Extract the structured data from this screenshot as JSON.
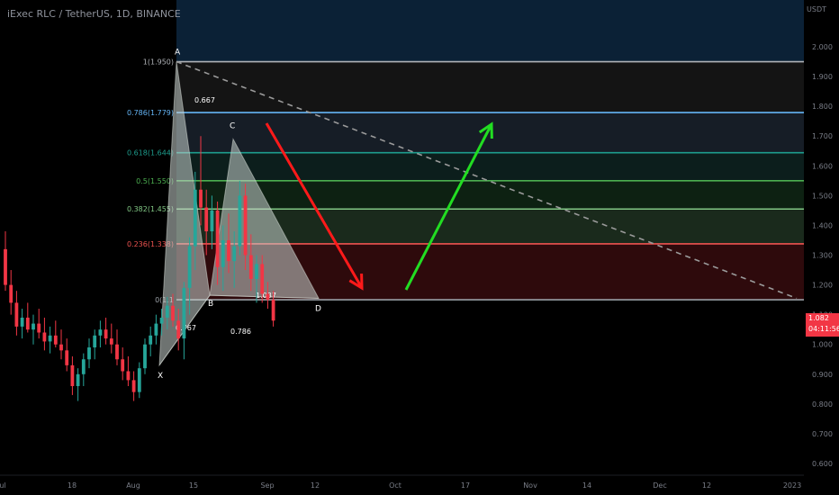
{
  "title": "iExec RLC / TetherUS, 1D, BINANCE",
  "price_unit": "USDT",
  "last_price": "1.082",
  "countdown": "04:11:56",
  "colors": {
    "up": "#26a69a",
    "down": "#f23645",
    "background": "#000000",
    "axis_text": "#7a7e88"
  },
  "chart_data": {
    "type": "candlestick",
    "title": "iExec RLC / TetherUS, 1D, BINANCE",
    "ylim": [
      0.56,
      2.1
    ],
    "y_ticks": [
      "2.000",
      "1.900",
      "1.800",
      "1.700",
      "1.600",
      "1.500",
      "1.400",
      "1.300",
      "1.200",
      "1.100",
      "1.000",
      "0.900",
      "0.800",
      "0.700",
      "0.600"
    ],
    "y_tick_values": [
      2.0,
      1.9,
      1.8,
      1.7,
      1.6,
      1.5,
      1.4,
      1.3,
      1.2,
      1.1,
      1.0,
      0.9,
      0.8,
      0.7,
      0.6
    ],
    "x_ticks": [
      "ul",
      "18",
      "Aug",
      "15",
      "Sep",
      "12",
      "Oct",
      "17",
      "Nov",
      "14",
      "Dec",
      "12",
      "2023"
    ],
    "fibonacci": {
      "levels": [
        {
          "ratio": 1,
          "label": "1(1.950)",
          "price": 1.95,
          "color": "#b0b3b8",
          "fill": "#141414"
        },
        {
          "ratio": 0.786,
          "label": "0.786(1.779)",
          "price": 1.779,
          "color": "#64b5f6",
          "fill": "#161d26"
        },
        {
          "ratio": 0.618,
          "label": "0.618(1.644)",
          "price": 1.644,
          "color": "#1e9e8e",
          "fill": "#0c1e1c"
        },
        {
          "ratio": 0.5,
          "label": "0.5(1.550)",
          "price": 1.55,
          "color": "#4caf50",
          "fill": "#0d2112"
        },
        {
          "ratio": 0.382,
          "label": "0.382(1.455)",
          "price": 1.455,
          "color": "#81c784",
          "fill": "#1a2a1c"
        },
        {
          "ratio": 0.236,
          "label": "0.236(1.338)",
          "price": 1.338,
          "color": "#ef5350",
          "fill": "#2e0a0c"
        },
        {
          "ratio": 0,
          "label": "0(1.1",
          "price": 1.15,
          "color": "#9aa0a6",
          "fill": "#000000"
        }
      ],
      "top_band_color": "#0b2136"
    },
    "pattern": {
      "points": [
        {
          "label": "X",
          "price": 0.93
        },
        {
          "label": "A",
          "price": 1.95
        },
        {
          "label": "B",
          "price": 1.165
        },
        {
          "label": "C",
          "price": 1.69
        },
        {
          "label": "D",
          "price": 1.155
        }
      ],
      "ratios": [
        "0.767",
        "0.667",
        "0.786",
        "1.037"
      ]
    },
    "candles": [
      {
        "o": 1.32,
        "h": 1.38,
        "l": 1.18,
        "c": 1.2
      },
      {
        "o": 1.2,
        "h": 1.25,
        "l": 1.1,
        "c": 1.14
      },
      {
        "o": 1.14,
        "h": 1.18,
        "l": 1.03,
        "c": 1.06
      },
      {
        "o": 1.06,
        "h": 1.12,
        "l": 1.02,
        "c": 1.09
      },
      {
        "o": 1.09,
        "h": 1.14,
        "l": 1.04,
        "c": 1.05
      },
      {
        "o": 1.05,
        "h": 1.1,
        "l": 1.0,
        "c": 1.07
      },
      {
        "o": 1.07,
        "h": 1.12,
        "l": 1.02,
        "c": 1.04
      },
      {
        "o": 1.04,
        "h": 1.09,
        "l": 0.98,
        "c": 1.01
      },
      {
        "o": 1.01,
        "h": 1.06,
        "l": 0.97,
        "c": 1.03
      },
      {
        "o": 1.03,
        "h": 1.08,
        "l": 0.99,
        "c": 1.0
      },
      {
        "o": 1.0,
        "h": 1.05,
        "l": 0.95,
        "c": 0.98
      },
      {
        "o": 0.98,
        "h": 1.02,
        "l": 0.91,
        "c": 0.93
      },
      {
        "o": 0.93,
        "h": 0.96,
        "l": 0.83,
        "c": 0.86
      },
      {
        "o": 0.86,
        "h": 0.92,
        "l": 0.81,
        "c": 0.9
      },
      {
        "o": 0.9,
        "h": 0.97,
        "l": 0.86,
        "c": 0.95
      },
      {
        "o": 0.95,
        "h": 1.02,
        "l": 0.92,
        "c": 0.99
      },
      {
        "o": 0.99,
        "h": 1.05,
        "l": 0.95,
        "c": 1.03
      },
      {
        "o": 1.03,
        "h": 1.08,
        "l": 0.99,
        "c": 1.05
      },
      {
        "o": 1.05,
        "h": 1.09,
        "l": 1.0,
        "c": 1.02
      },
      {
        "o": 1.02,
        "h": 1.07,
        "l": 0.97,
        "c": 1.0
      },
      {
        "o": 1.0,
        "h": 1.05,
        "l": 0.93,
        "c": 0.95
      },
      {
        "o": 0.95,
        "h": 0.99,
        "l": 0.88,
        "c": 0.91
      },
      {
        "o": 0.91,
        "h": 0.96,
        "l": 0.86,
        "c": 0.88
      },
      {
        "o": 0.88,
        "h": 0.91,
        "l": 0.81,
        "c": 0.84
      },
      {
        "o": 0.84,
        "h": 0.94,
        "l": 0.82,
        "c": 0.92
      },
      {
        "o": 0.92,
        "h": 1.02,
        "l": 0.9,
        "c": 1.0
      },
      {
        "o": 1.0,
        "h": 1.06,
        "l": 0.96,
        "c": 1.03
      },
      {
        "o": 1.03,
        "h": 1.1,
        "l": 1.0,
        "c": 1.07
      },
      {
        "o": 1.07,
        "h": 1.12,
        "l": 1.03,
        "c": 1.09
      },
      {
        "o": 1.09,
        "h": 1.16,
        "l": 1.05,
        "c": 1.13
      },
      {
        "o": 1.13,
        "h": 1.17,
        "l": 1.06,
        "c": 1.08
      },
      {
        "o": 1.08,
        "h": 1.12,
        "l": 0.98,
        "c": 1.02
      },
      {
        "o": 1.02,
        "h": 1.21,
        "l": 0.95,
        "c": 1.19
      },
      {
        "o": 1.19,
        "h": 1.36,
        "l": 1.1,
        "c": 1.33
      },
      {
        "o": 1.33,
        "h": 1.58,
        "l": 1.25,
        "c": 1.52
      },
      {
        "o": 1.52,
        "h": 1.7,
        "l": 1.4,
        "c": 1.46
      },
      {
        "o": 1.46,
        "h": 1.52,
        "l": 1.3,
        "c": 1.38
      },
      {
        "o": 1.38,
        "h": 1.5,
        "l": 1.32,
        "c": 1.45
      },
      {
        "o": 1.45,
        "h": 1.48,
        "l": 1.2,
        "c": 1.26
      },
      {
        "o": 1.26,
        "h": 1.4,
        "l": 1.18,
        "c": 1.35
      },
      {
        "o": 1.35,
        "h": 1.44,
        "l": 1.24,
        "c": 1.28
      },
      {
        "o": 1.28,
        "h": 1.38,
        "l": 1.19,
        "c": 1.33
      },
      {
        "o": 1.33,
        "h": 1.55,
        "l": 1.3,
        "c": 1.5
      },
      {
        "o": 1.5,
        "h": 1.54,
        "l": 1.25,
        "c": 1.3
      },
      {
        "o": 1.3,
        "h": 1.37,
        "l": 1.18,
        "c": 1.22
      },
      {
        "o": 1.22,
        "h": 1.3,
        "l": 1.14,
        "c": 1.27
      },
      {
        "o": 1.27,
        "h": 1.3,
        "l": 1.14,
        "c": 1.17
      },
      {
        "o": 1.17,
        "h": 1.21,
        "l": 1.12,
        "c": 1.15
      },
      {
        "o": 1.15,
        "h": 1.18,
        "l": 1.06,
        "c": 1.08
      }
    ]
  }
}
